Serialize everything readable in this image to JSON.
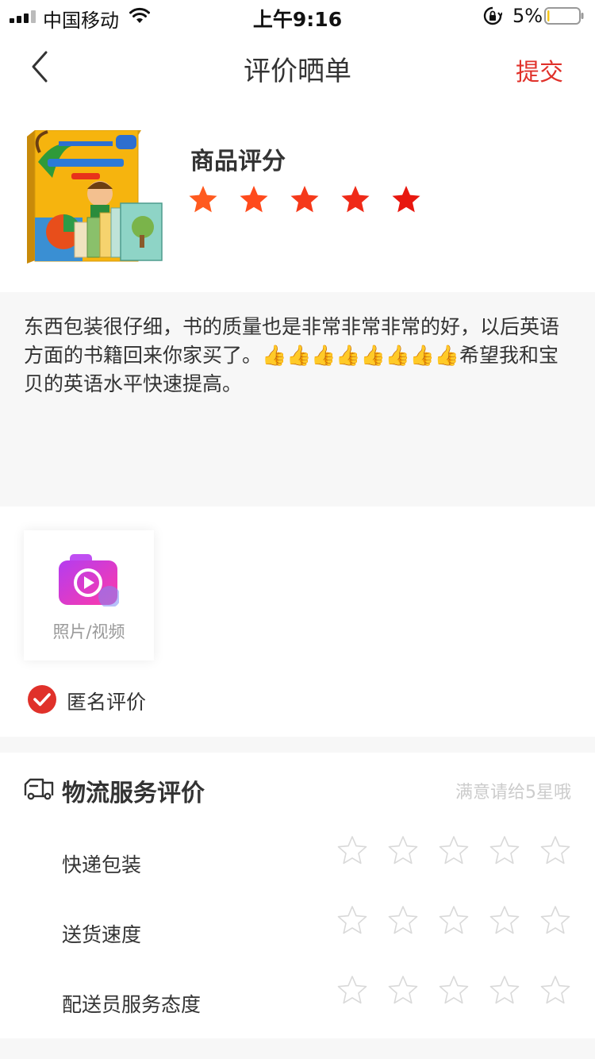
{
  "status_bar": {
    "carrier": "中国移动",
    "time": "上午9:16",
    "battery_percent": "5%",
    "battery_level": 0.05
  },
  "nav": {
    "title": "评价晒单",
    "submit_label": "提交"
  },
  "product": {
    "rating_label": "商品评分",
    "rating": 5,
    "max_rating": 5,
    "star_colors": [
      "#ff5a1f",
      "#ff4a1c",
      "#f5391a",
      "#ef2a18",
      "#e8170f"
    ]
  },
  "review": {
    "text": "东西包装很仔细，书的质量也是非常非常非常的好，以后英语方面的书籍回来你家买了。👍👍👍👍👍👍👍👍希望我和宝贝的英语水平快速提高。"
  },
  "media": {
    "upload_label": "照片/视频",
    "anonymous_label": "匿名评价",
    "anonymous_checked": true
  },
  "logistics": {
    "title": "物流服务评价",
    "hint": "满意请给5星哦",
    "rows": [
      {
        "label": "快递包装",
        "rating": 0
      },
      {
        "label": "送货速度",
        "rating": 0
      },
      {
        "label": "配送员服务态度",
        "rating": 0
      }
    ]
  },
  "colors": {
    "accent": "#e0312a",
    "empty_star": "#d9d9d9"
  }
}
